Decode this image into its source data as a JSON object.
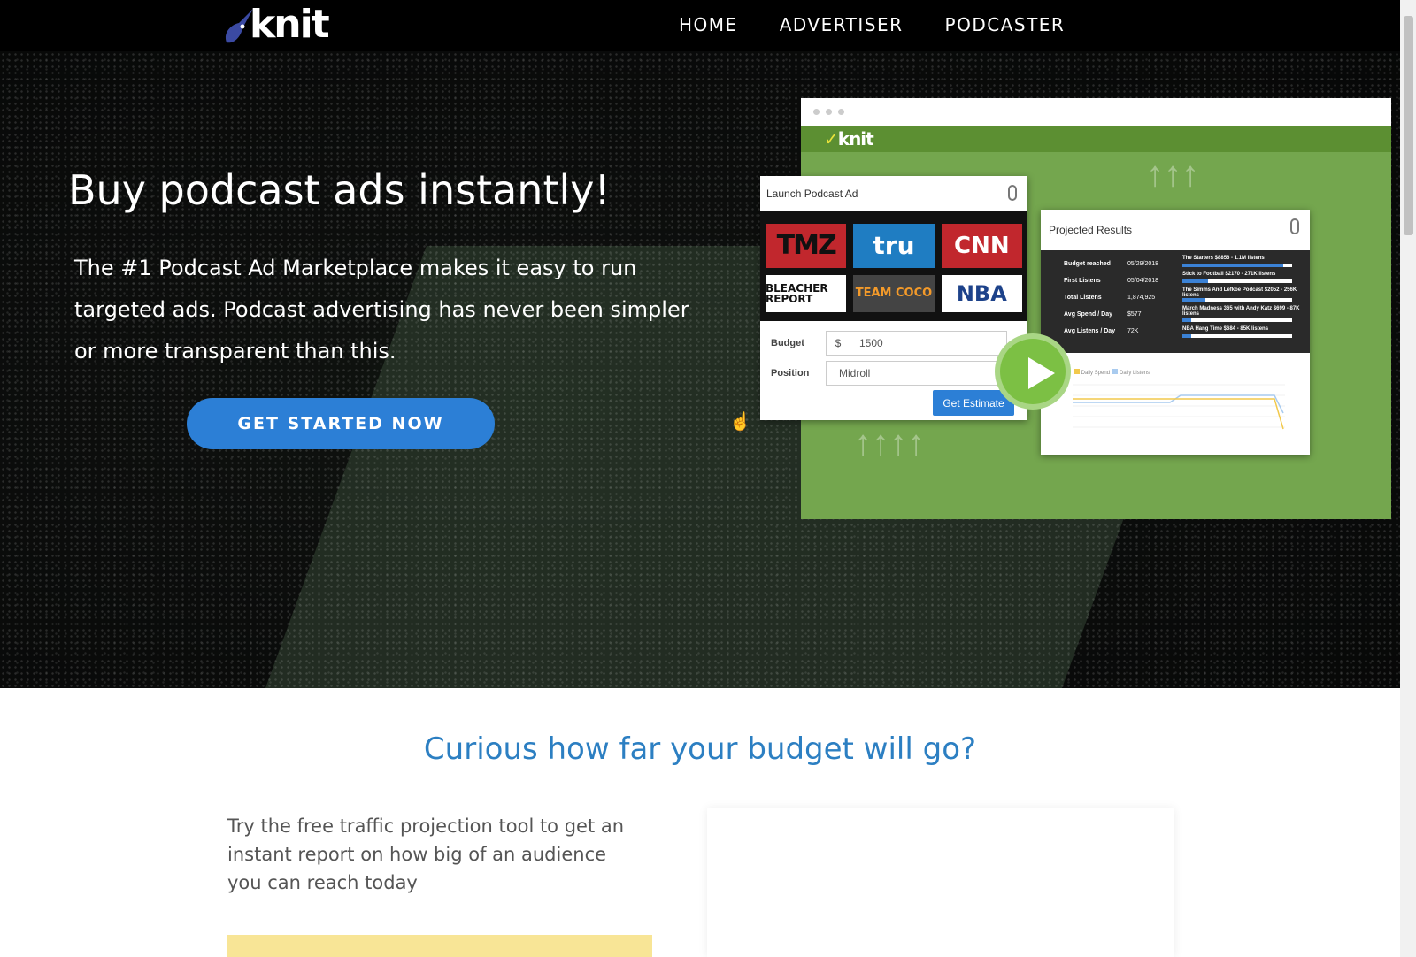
{
  "header": {
    "logo_text": "knit",
    "nav": [
      {
        "label": "HOME"
      },
      {
        "label": "ADVERTISER"
      },
      {
        "label": "PODCASTER"
      }
    ]
  },
  "hero": {
    "title": "Buy podcast ads instantly!",
    "description": "The #1 Podcast Ad Marketplace makes it easy to run targeted ads. Podcast advertising has never been simpler or more transparent than this.",
    "cta_label": "GET STARTED NOW"
  },
  "mockup": {
    "logo_text": "knit",
    "launch_title": "Launch Podcast Ad",
    "brands": [
      "TMZ",
      "tru",
      "CNN",
      "BLEACHER REPORT",
      "TEAM COCO",
      "NBA"
    ],
    "budget_label": "Budget",
    "currency": "$",
    "budget_value": "1500",
    "position_label": "Position",
    "position_value": "Midroll",
    "estimate_button": "Get Estimate",
    "results_title": "Projected Results",
    "results_rows": [
      {
        "label": "Budget reached",
        "value": "05/29/2018"
      },
      {
        "label": "First Listens",
        "value": "05/04/2018"
      },
      {
        "label": "Total Listens",
        "value": "1,874,925"
      },
      {
        "label": "Avg Spend / Day",
        "value": "$577"
      },
      {
        "label": "Avg Listens / Day",
        "value": "72K"
      }
    ],
    "results_shows": [
      {
        "label": "The Starters $8856 - 1.1M listens",
        "fill": 0.92
      },
      {
        "label": "Stick to Football $2170 - 271K listens",
        "fill": 0.23
      },
      {
        "label": "The Simms And Lefkoe Podcast $2052 - 256K listens",
        "fill": 0.21
      },
      {
        "label": "March Madness 365 with Andy Katz $699 - 87K listens",
        "fill": 0.08
      },
      {
        "label": "NBA Hang Time $684 - 85K listens",
        "fill": 0.08
      }
    ],
    "legend": [
      "Daily Spend",
      "Daily Listens"
    ]
  },
  "budget_section": {
    "title": "Curious how far your budget will go?",
    "description": "Try the free traffic projection tool to get an instant report on how big of an audience you can reach today"
  },
  "colors": {
    "brand_blue": "#2c7fd6",
    "heading_blue": "#2c7fc2",
    "mock_green": "#74a64e",
    "play_green": "#7cc044"
  }
}
